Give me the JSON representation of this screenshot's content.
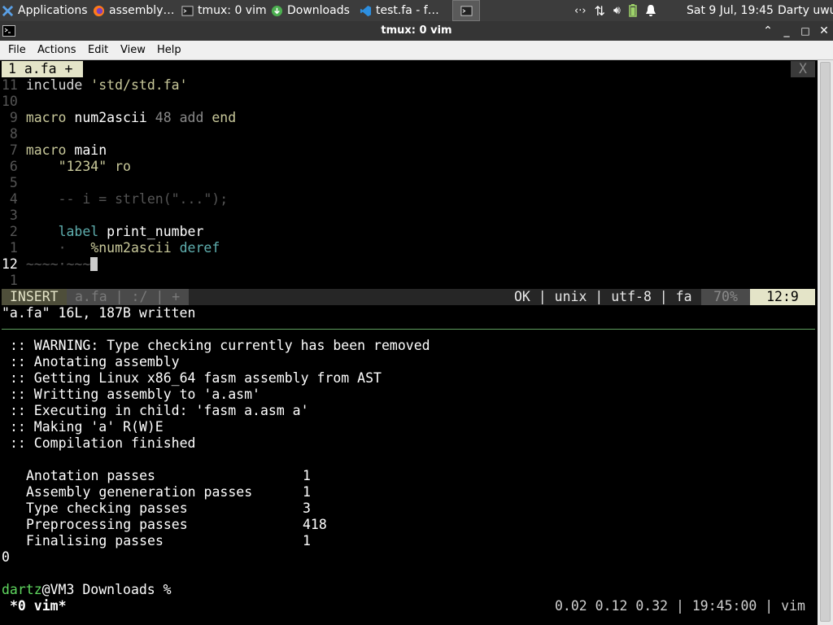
{
  "panel": {
    "tasks": [
      {
        "label": "Applications ☰",
        "icon": "xfce-mouse-icon"
      },
      {
        "label": "assembly…",
        "icon": "firefox-icon"
      },
      {
        "label": "tmux: 0 vim",
        "icon": "terminal-icon"
      },
      {
        "label": "Downloads",
        "icon": "download-icon"
      },
      {
        "label": "test.fa - f…",
        "icon": "vscode-icon"
      },
      {
        "label": "",
        "icon": "terminal-icon"
      }
    ],
    "datetime": "Sat  9 Jul, 19:45",
    "user": "Darty uwu",
    "tray_icons": [
      "network-icon",
      "transfer-icon",
      "volume-icon",
      "battery-icon",
      "bell-icon"
    ]
  },
  "window": {
    "title": "tmux: 0 vim",
    "buttons": [
      "minimize-button",
      "maximize-button",
      "restore-button",
      "close-button"
    ]
  },
  "menubar": {
    "items": [
      "File",
      "Actions",
      "Edit",
      "View",
      "Help"
    ]
  },
  "vim": {
    "tab": "1 a.fa +",
    "tab_close": "X",
    "lines": [
      {
        "num": "11",
        "code": "include 'std/std.fa'"
      },
      {
        "num": "10",
        "code": ""
      },
      {
        "num": " 9",
        "code": "macro num2ascii 48 add end"
      },
      {
        "num": " 8",
        "code": ""
      },
      {
        "num": " 7",
        "code": "macro main"
      },
      {
        "num": " 6",
        "code": "    \"1234\" ro"
      },
      {
        "num": " 5",
        "code": ""
      },
      {
        "num": " 4",
        "code": "    -- i = strlen(\"...\");"
      },
      {
        "num": " 3",
        "code": ""
      },
      {
        "num": " 2",
        "code": "    label print_number"
      },
      {
        "num": " 1",
        "code": "    ·   %num2ascii deref"
      },
      {
        "num": "12",
        "code": "~~~~·~~~"
      },
      {
        "num": " 1",
        "code": ""
      }
    ],
    "status": {
      "mode": "INSERT",
      "file": "a.fa | :/ | +",
      "info": "OK | unix | utf-8 | fa",
      "percent": "70%",
      "position": "12:9"
    },
    "message": "\"a.fa\" 16L, 187B written"
  },
  "shell": {
    "output": [
      ":: WARNING: Type checking currently has been removed",
      ":: Anotating assembly",
      ":: Getting Linux x86_64 fasm assembly from AST",
      ":: Writting assembly to 'a.asm'",
      ":: Executing in child: 'fasm a.asm a'",
      ":: Making 'a' R(W)E",
      ":: Compilation finished"
    ],
    "passes": [
      {
        "label": "Anotation passes",
        "value": "1"
      },
      {
        "label": "Assembly geneneration passes",
        "value": "1"
      },
      {
        "label": "Type checking passes",
        "value": "3"
      },
      {
        "label": "Preprocessing passes",
        "value": "418"
      },
      {
        "label": "Finalising passes",
        "value": "1"
      }
    ],
    "exit_code": "0",
    "prompt_user": "dartz",
    "prompt_rest": "@VM3 Downloads % "
  },
  "tmux": {
    "window": "*0 vim*",
    "right": "0.02 0.12 0.32 | 19:45:00 | vim"
  }
}
